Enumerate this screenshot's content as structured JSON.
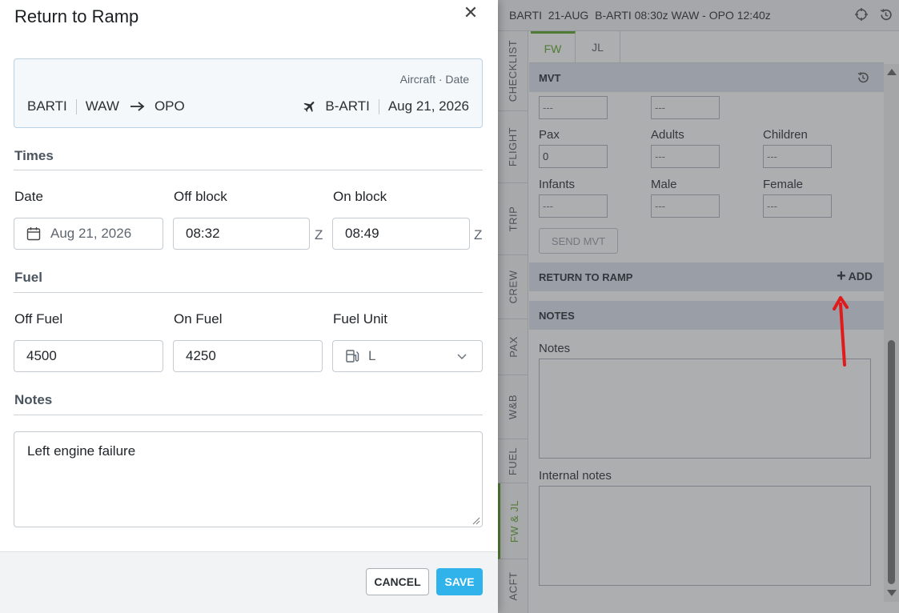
{
  "modal": {
    "title": "Return to Ramp",
    "close_glyph": "✕",
    "info": {
      "meta": "Aircraft · Date",
      "callsign": "BARTI",
      "origin": "WAW",
      "destination": "OPO",
      "registration": "B-ARTI",
      "date": "Aug 21, 2026"
    },
    "times": {
      "title": "Times",
      "date_label": "Date",
      "date_value": "Aug 21, 2026",
      "off_block_label": "Off block",
      "off_block_value": "08:32",
      "on_block_label": "On block",
      "on_block_value": "08:49",
      "zone_suffix": "Z"
    },
    "fuel": {
      "title": "Fuel",
      "off_fuel_label": "Off Fuel",
      "off_fuel_value": "4500",
      "on_fuel_label": "On Fuel",
      "on_fuel_value": "4250",
      "unit_label": "Fuel Unit",
      "unit_value": "L"
    },
    "notes": {
      "title": "Notes",
      "value": "Left engine failure"
    },
    "footer": {
      "cancel": "CANCEL",
      "save": "SAVE"
    }
  },
  "background": {
    "topbar": "BARTI  21-AUG  B-ARTI 08:30z WAW - OPO 12:40z",
    "side_tabs": [
      "CHECKLIST",
      "FLIGHT",
      "TRIP",
      "CREW",
      "PAX",
      "W&B",
      "FUEL",
      "FW & JL",
      "ACFT"
    ],
    "subtabs": [
      "FW",
      "JL"
    ],
    "mvt_header": "MVT",
    "placeholder": "---",
    "pax_label": "Pax",
    "pax_value": "0",
    "adults_label": "Adults",
    "children_label": "Children",
    "infants_label": "Infants",
    "male_label": "Male",
    "female_label": "Female",
    "send_mvt": "SEND MVT",
    "rtr_header": "RETURN TO RAMP",
    "add_label": "ADD",
    "notes_header": "NOTES",
    "notes_label": "Notes",
    "internal_notes_label": "Internal notes"
  },
  "colors": {
    "accent_green": "#5fa82a",
    "save_blue": "#2fb3ea",
    "annotation_red": "#e01b1b"
  }
}
